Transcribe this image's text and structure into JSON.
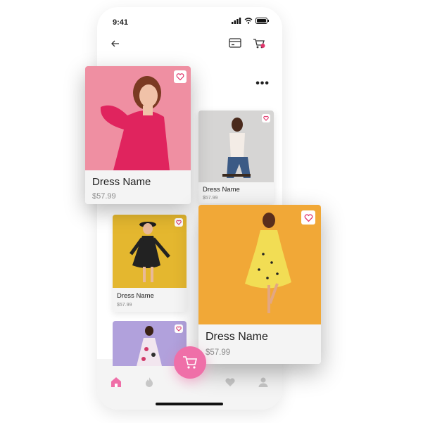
{
  "status_bar": {
    "time": "9:41"
  },
  "icons": {
    "back": "arrow-left-icon",
    "card": "credit-card-icon",
    "cart": "cart-icon",
    "more": "more-horizontal-icon",
    "favorite": "heart-icon",
    "fab": "shopping-cart-icon",
    "tabs": [
      "home-icon",
      "flame-icon",
      "heart-icon",
      "user-icon"
    ]
  },
  "more_menu": "•••",
  "products": [
    {
      "name": "Dress Name",
      "price": "$57.99"
    },
    {
      "name": "Dress Name",
      "price": "$57.99"
    },
    {
      "name": "Dress Name",
      "price": "$57.99"
    },
    {
      "name": "Dress Name",
      "price": "$57.99"
    }
  ],
  "colors": {
    "accent": "#ef6fa8",
    "favorite_accent": "#e0356b",
    "card_info_bg": "#f4f4f4",
    "photo_pink": "#ef8fa2",
    "photo_grey": "#d6d5d4",
    "photo_yellow": "#e4b72f",
    "photo_lavender": "#b1a1dc",
    "photo_orange": "#f1a837"
  }
}
